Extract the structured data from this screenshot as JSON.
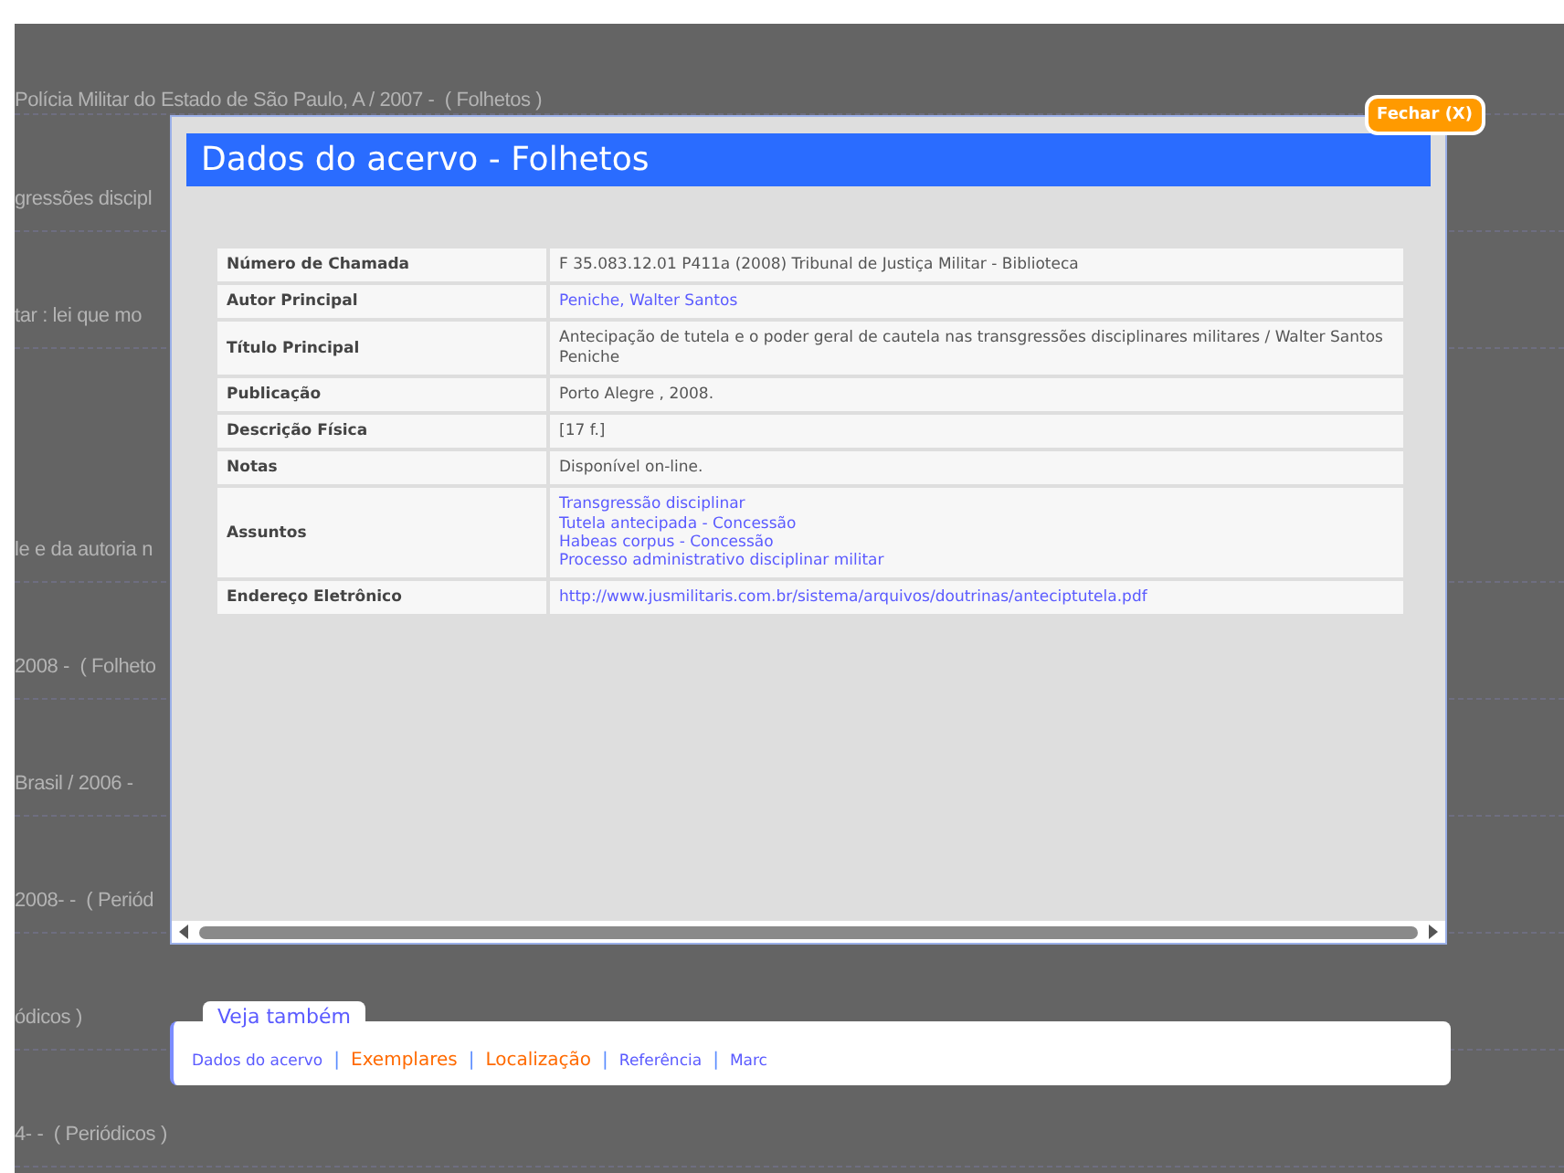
{
  "background_list": [
    {
      "text": "Polícia Militar do Estado de São Paulo, A / 2007 -  ( Folhetos )"
    },
    {
      "text": "gressões discipl"
    },
    {
      "text": "tar : lei que mo"
    },
    {
      "text": "le e da autoria n"
    },
    {
      "text": "2008 -  ( Folheto"
    },
    {
      "text": "Brasil / 2006 -"
    },
    {
      "text": "2008- -  ( Periód"
    },
    {
      "text": "ódicos )"
    },
    {
      "text": "4- -  ( Periódicos )"
    }
  ],
  "modal": {
    "title": "Dados do acervo - Folhetos",
    "close_button": "Fechar (X)",
    "rows": [
      {
        "label": "Número de Chamada",
        "kind": "text",
        "values": [
          "F 35.083.12.01 P411a (2008)  Tribunal de Justiça Militar - Biblioteca"
        ]
      },
      {
        "label": "Autor Principal",
        "kind": "link",
        "values": [
          "Peniche, Walter Santos"
        ]
      },
      {
        "label": "Título Principal",
        "kind": "text",
        "values": [
          "Antecipação de tutela e o poder geral de cautela nas transgressões disciplinares militares / Walter Santos Peniche"
        ]
      },
      {
        "label": "Publicação",
        "kind": "text",
        "values": [
          "Porto Alegre , 2008."
        ]
      },
      {
        "label": "Descrição Física",
        "kind": "text",
        "values": [
          "[17 f.]"
        ]
      },
      {
        "label": "Notas",
        "kind": "text",
        "values": [
          "Disponível on-line."
        ]
      },
      {
        "label": "Assuntos",
        "kind": "link",
        "values": [
          "Transgressão disciplinar",
          "Tutela antecipada - Concessão",
          "Habeas corpus - Concessão",
          "Processo administrativo disciplinar militar"
        ]
      },
      {
        "label": "Endereço Eletrônico",
        "kind": "link",
        "values": [
          "http://www.jusmilitaris.com.br/sistema/arquivos/doutrinas/anteciptutela.pdf"
        ]
      }
    ]
  },
  "see_also": {
    "title": "Veja também",
    "links": [
      {
        "label": "Dados do acervo",
        "color": "#5a5aff",
        "separator": "|"
      },
      {
        "label": "Exemplares",
        "color": "#ff6a00",
        "separator": "|"
      },
      {
        "label": "Localização",
        "color": "#ff6a00",
        "separator": "|"
      },
      {
        "label": "Referência",
        "color": "#5a5aff",
        "separator": "|"
      },
      {
        "label": "Marc",
        "color": "#5a5aff"
      }
    ]
  }
}
